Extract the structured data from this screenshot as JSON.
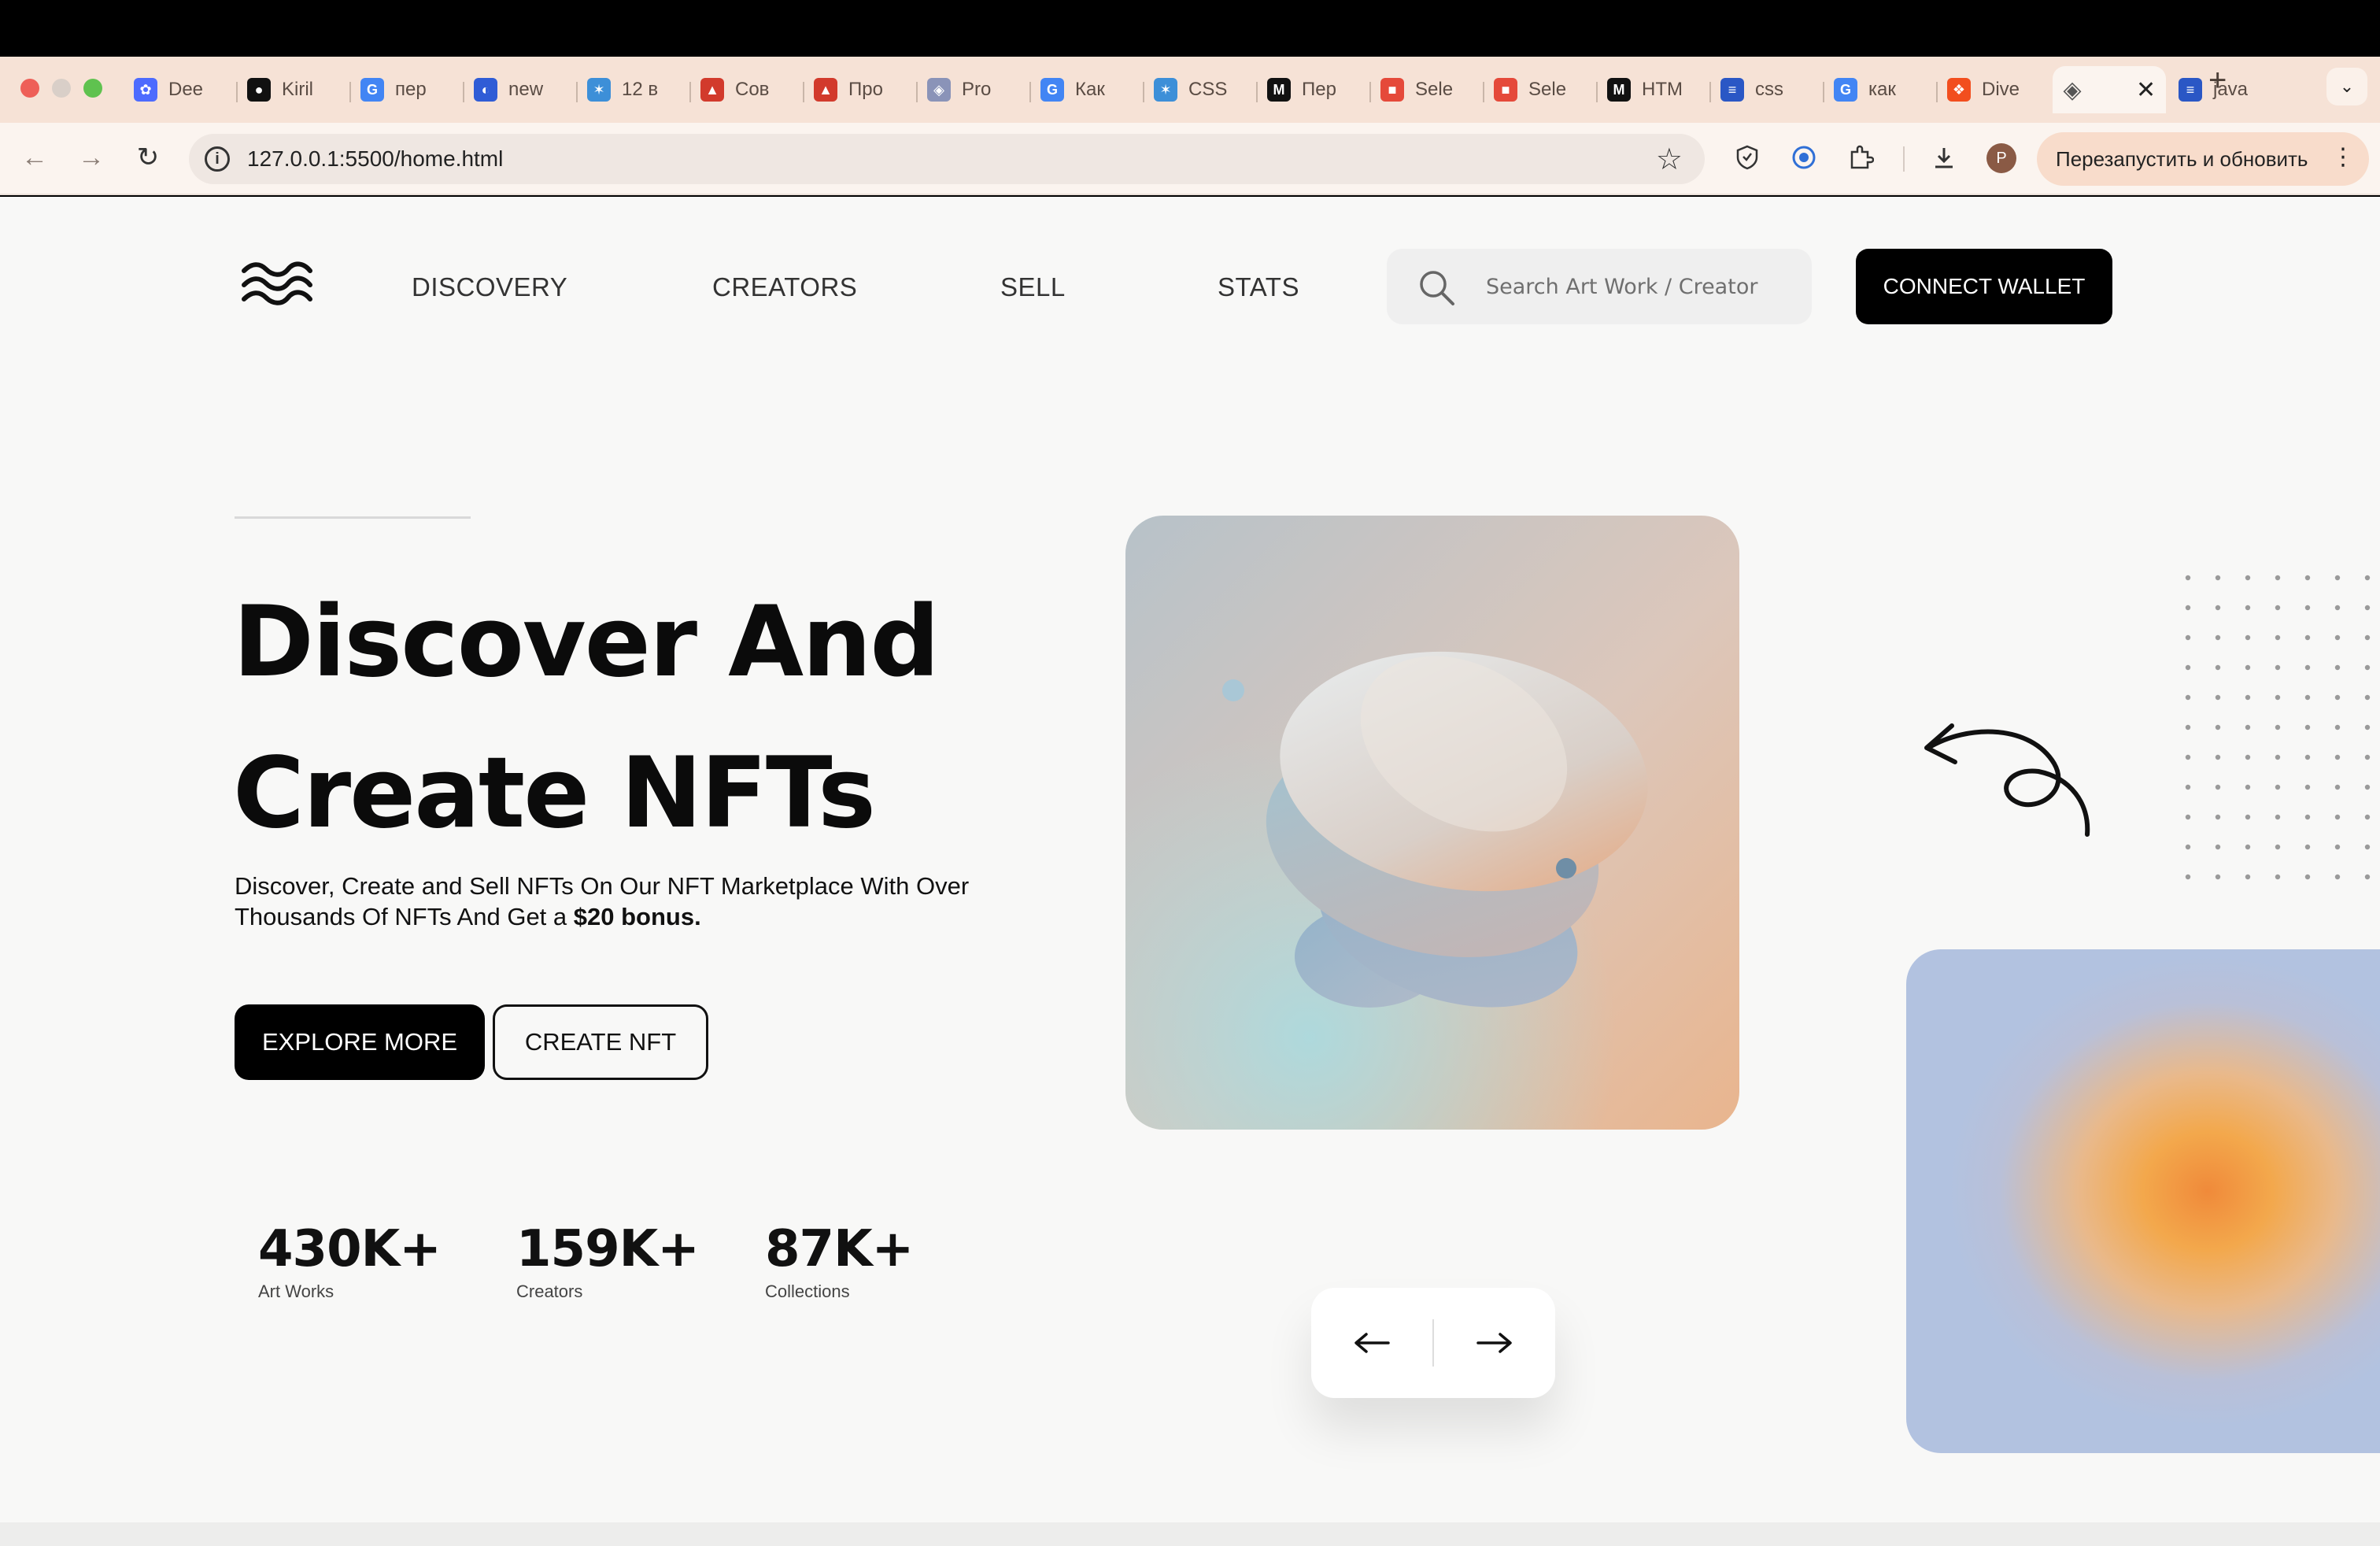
{
  "browser": {
    "tabs": [
      {
        "label": "Dee",
        "icon": "deepseek-icon",
        "color": "#4d6bfe"
      },
      {
        "label": "Kiril",
        "icon": "github-icon",
        "color": "#111111"
      },
      {
        "label": "пер",
        "icon": "google-icon",
        "color": "#4285f4"
      },
      {
        "label": "new",
        "icon": "chatgpt-icon",
        "color": "#2f5cd6"
      },
      {
        "label": "12 в",
        "icon": "tilda-icon",
        "color": "#3d8fd8"
      },
      {
        "label": "Сов",
        "icon": "tower-icon",
        "color": "#d23a2c"
      },
      {
        "label": "Про",
        "icon": "tower-icon",
        "color": "#d23a2c"
      },
      {
        "label": "Pro",
        "icon": "globe-icon",
        "color": "#8a93b8"
      },
      {
        "label": "Как",
        "icon": "google-icon",
        "color": "#4285f4"
      },
      {
        "label": "CSS",
        "icon": "tilda-icon",
        "color": "#3d8fd8"
      },
      {
        "label": "Пер",
        "icon": "m-icon",
        "color": "#111111"
      },
      {
        "label": "Sele",
        "icon": "puzzle-icon",
        "color": "#e5493a"
      },
      {
        "label": "Sele",
        "icon": "puzzle-icon",
        "color": "#e5493a"
      },
      {
        "label": "HTM",
        "icon": "m-icon",
        "color": "#111111"
      },
      {
        "label": "css",
        "icon": "stack-icon",
        "color": "#2a57c5"
      },
      {
        "label": "как",
        "icon": "google-icon",
        "color": "#4285f4"
      },
      {
        "label": "Dive",
        "icon": "figma-icon",
        "color": "#f24e1e"
      },
      {
        "label": "",
        "icon": "globe-icon",
        "color": "#555555",
        "active": true
      },
      {
        "label": "java",
        "icon": "stack-icon",
        "color": "#2a57c5"
      }
    ],
    "url": "127.0.0.1:5500/home.html",
    "profile_initial": "P",
    "relaunch_label": "Перезапустить и обновить"
  },
  "site": {
    "nav": [
      "DISCOVERY",
      "CREATORS",
      "SELL",
      "STATS"
    ],
    "search_placeholder": "Search Art Work / Creator",
    "connect_label": "CONNECT WALLET",
    "hero": {
      "title_line1": "Discover And",
      "title_line2": "Create NFTs",
      "subtitle": "Discover, Create and Sell NFTs On Our NFT Marketplace With Over Thousands Of NFTs And Get a",
      "subtitle_bold": "$20 bonus."
    },
    "buttons": {
      "explore": "EXPLORE MORE",
      "create": "CREATE NFT"
    },
    "stats": [
      {
        "value": "430K+",
        "label": "Art Works"
      },
      {
        "value": "159K+",
        "label": "Creators"
      },
      {
        "value": "87K+",
        "label": "Collections"
      }
    ]
  },
  "colors": {
    "accent": "#000000",
    "page_bg": "#f8f8f7",
    "tabstrip_bg": "#f6e2d6"
  }
}
